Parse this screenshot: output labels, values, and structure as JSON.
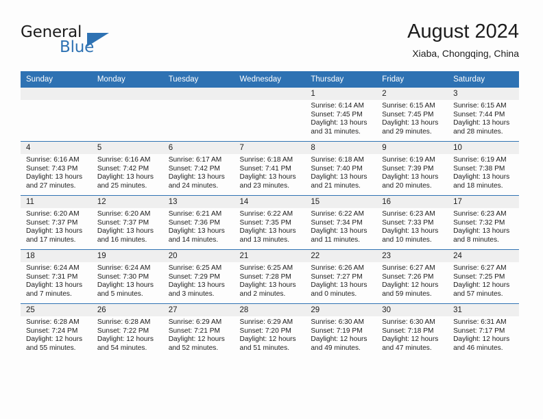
{
  "brand": {
    "name_top": "General",
    "name_bottom": "Blue",
    "accent_color": "#2e72b3",
    "logo_icon": "triangle-flag-icon"
  },
  "header": {
    "month_title": "August 2024",
    "location": "Xiaba, Chongqing, China"
  },
  "calendar": {
    "header_background": "#2e72b3",
    "daynum_band_background": "#efefef",
    "weekday_headers": [
      "Sunday",
      "Monday",
      "Tuesday",
      "Wednesday",
      "Thursday",
      "Friday",
      "Saturday"
    ],
    "weeks": [
      [
        {
          "day": "",
          "lines": []
        },
        {
          "day": "",
          "lines": []
        },
        {
          "day": "",
          "lines": []
        },
        {
          "day": "",
          "lines": []
        },
        {
          "day": "1",
          "lines": [
            "Sunrise: 6:14 AM",
            "Sunset: 7:45 PM",
            "Daylight: 13 hours",
            "and 31 minutes."
          ]
        },
        {
          "day": "2",
          "lines": [
            "Sunrise: 6:15 AM",
            "Sunset: 7:45 PM",
            "Daylight: 13 hours",
            "and 29 minutes."
          ]
        },
        {
          "day": "3",
          "lines": [
            "Sunrise: 6:15 AM",
            "Sunset: 7:44 PM",
            "Daylight: 13 hours",
            "and 28 minutes."
          ]
        }
      ],
      [
        {
          "day": "4",
          "lines": [
            "Sunrise: 6:16 AM",
            "Sunset: 7:43 PM",
            "Daylight: 13 hours",
            "and 27 minutes."
          ]
        },
        {
          "day": "5",
          "lines": [
            "Sunrise: 6:16 AM",
            "Sunset: 7:42 PM",
            "Daylight: 13 hours",
            "and 25 minutes."
          ]
        },
        {
          "day": "6",
          "lines": [
            "Sunrise: 6:17 AM",
            "Sunset: 7:42 PM",
            "Daylight: 13 hours",
            "and 24 minutes."
          ]
        },
        {
          "day": "7",
          "lines": [
            "Sunrise: 6:18 AM",
            "Sunset: 7:41 PM",
            "Daylight: 13 hours",
            "and 23 minutes."
          ]
        },
        {
          "day": "8",
          "lines": [
            "Sunrise: 6:18 AM",
            "Sunset: 7:40 PM",
            "Daylight: 13 hours",
            "and 21 minutes."
          ]
        },
        {
          "day": "9",
          "lines": [
            "Sunrise: 6:19 AM",
            "Sunset: 7:39 PM",
            "Daylight: 13 hours",
            "and 20 minutes."
          ]
        },
        {
          "day": "10",
          "lines": [
            "Sunrise: 6:19 AM",
            "Sunset: 7:38 PM",
            "Daylight: 13 hours",
            "and 18 minutes."
          ]
        }
      ],
      [
        {
          "day": "11",
          "lines": [
            "Sunrise: 6:20 AM",
            "Sunset: 7:37 PM",
            "Daylight: 13 hours",
            "and 17 minutes."
          ]
        },
        {
          "day": "12",
          "lines": [
            "Sunrise: 6:20 AM",
            "Sunset: 7:37 PM",
            "Daylight: 13 hours",
            "and 16 minutes."
          ]
        },
        {
          "day": "13",
          "lines": [
            "Sunrise: 6:21 AM",
            "Sunset: 7:36 PM",
            "Daylight: 13 hours",
            "and 14 minutes."
          ]
        },
        {
          "day": "14",
          "lines": [
            "Sunrise: 6:22 AM",
            "Sunset: 7:35 PM",
            "Daylight: 13 hours",
            "and 13 minutes."
          ]
        },
        {
          "day": "15",
          "lines": [
            "Sunrise: 6:22 AM",
            "Sunset: 7:34 PM",
            "Daylight: 13 hours",
            "and 11 minutes."
          ]
        },
        {
          "day": "16",
          "lines": [
            "Sunrise: 6:23 AM",
            "Sunset: 7:33 PM",
            "Daylight: 13 hours",
            "and 10 minutes."
          ]
        },
        {
          "day": "17",
          "lines": [
            "Sunrise: 6:23 AM",
            "Sunset: 7:32 PM",
            "Daylight: 13 hours",
            "and 8 minutes."
          ]
        }
      ],
      [
        {
          "day": "18",
          "lines": [
            "Sunrise: 6:24 AM",
            "Sunset: 7:31 PM",
            "Daylight: 13 hours",
            "and 7 minutes."
          ]
        },
        {
          "day": "19",
          "lines": [
            "Sunrise: 6:24 AM",
            "Sunset: 7:30 PM",
            "Daylight: 13 hours",
            "and 5 minutes."
          ]
        },
        {
          "day": "20",
          "lines": [
            "Sunrise: 6:25 AM",
            "Sunset: 7:29 PM",
            "Daylight: 13 hours",
            "and 3 minutes."
          ]
        },
        {
          "day": "21",
          "lines": [
            "Sunrise: 6:25 AM",
            "Sunset: 7:28 PM",
            "Daylight: 13 hours",
            "and 2 minutes."
          ]
        },
        {
          "day": "22",
          "lines": [
            "Sunrise: 6:26 AM",
            "Sunset: 7:27 PM",
            "Daylight: 13 hours",
            "and 0 minutes."
          ]
        },
        {
          "day": "23",
          "lines": [
            "Sunrise: 6:27 AM",
            "Sunset: 7:26 PM",
            "Daylight: 12 hours",
            "and 59 minutes."
          ]
        },
        {
          "day": "24",
          "lines": [
            "Sunrise: 6:27 AM",
            "Sunset: 7:25 PM",
            "Daylight: 12 hours",
            "and 57 minutes."
          ]
        }
      ],
      [
        {
          "day": "25",
          "lines": [
            "Sunrise: 6:28 AM",
            "Sunset: 7:24 PM",
            "Daylight: 12 hours",
            "and 55 minutes."
          ]
        },
        {
          "day": "26",
          "lines": [
            "Sunrise: 6:28 AM",
            "Sunset: 7:22 PM",
            "Daylight: 12 hours",
            "and 54 minutes."
          ]
        },
        {
          "day": "27",
          "lines": [
            "Sunrise: 6:29 AM",
            "Sunset: 7:21 PM",
            "Daylight: 12 hours",
            "and 52 minutes."
          ]
        },
        {
          "day": "28",
          "lines": [
            "Sunrise: 6:29 AM",
            "Sunset: 7:20 PM",
            "Daylight: 12 hours",
            "and 51 minutes."
          ]
        },
        {
          "day": "29",
          "lines": [
            "Sunrise: 6:30 AM",
            "Sunset: 7:19 PM",
            "Daylight: 12 hours",
            "and 49 minutes."
          ]
        },
        {
          "day": "30",
          "lines": [
            "Sunrise: 6:30 AM",
            "Sunset: 7:18 PM",
            "Daylight: 12 hours",
            "and 47 minutes."
          ]
        },
        {
          "day": "31",
          "lines": [
            "Sunrise: 6:31 AM",
            "Sunset: 7:17 PM",
            "Daylight: 12 hours",
            "and 46 minutes."
          ]
        }
      ]
    ]
  }
}
